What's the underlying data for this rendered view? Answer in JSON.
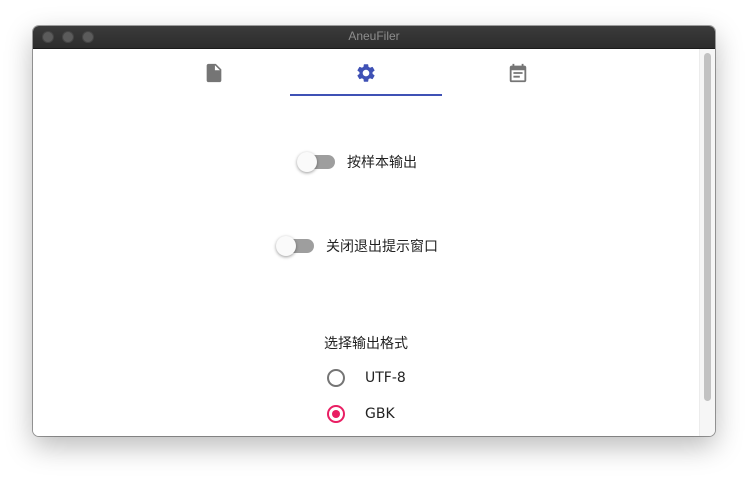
{
  "window": {
    "title": "AneuFiler"
  },
  "tabs": [
    {
      "icon": "file-icon",
      "selected": false
    },
    {
      "icon": "gear-icon",
      "selected": true
    },
    {
      "icon": "calendar-icon",
      "selected": false
    }
  ],
  "settings": {
    "sample_output": {
      "label": "按样本输出",
      "on": false
    },
    "exit_prompt": {
      "label": "关闭退出提示窗口",
      "on": false
    },
    "encoding": {
      "label": "选择输出格式",
      "options": [
        "UTF-8",
        "GBK"
      ],
      "selected": "GBK"
    }
  },
  "colors": {
    "accent": "#3f51b5",
    "radio_selected": "#e91e63",
    "icon_default": "#757575"
  }
}
